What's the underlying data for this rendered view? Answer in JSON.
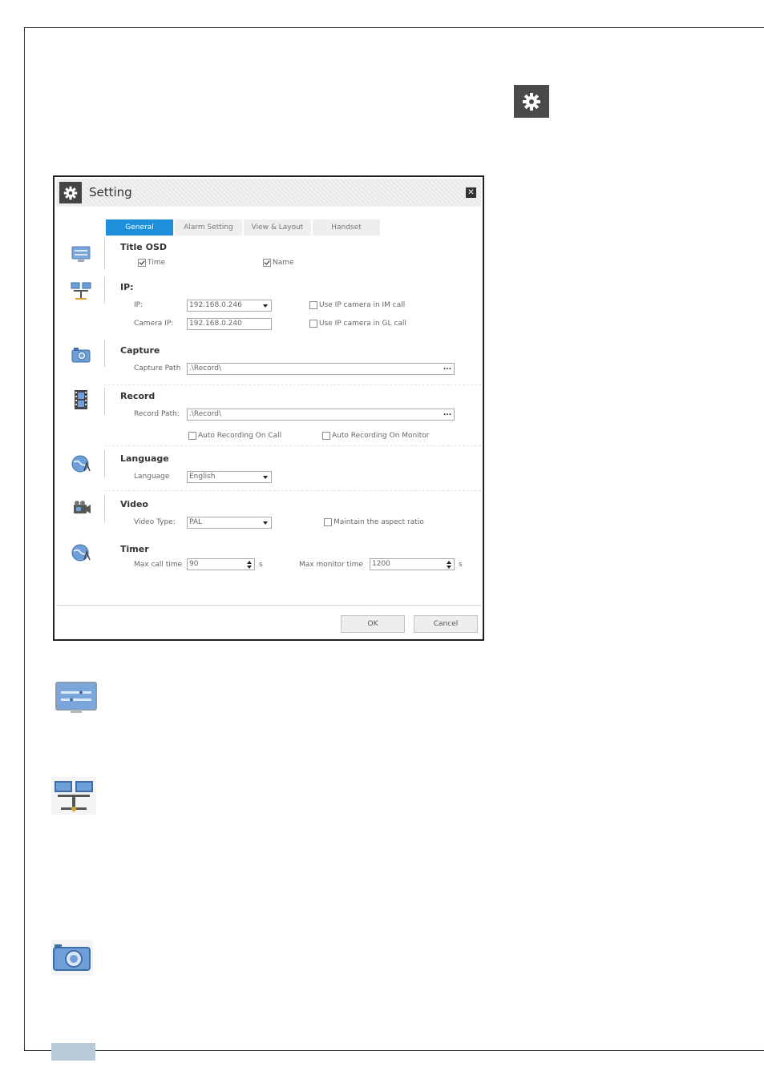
{
  "dialog": {
    "title": "Setting",
    "close_glyph": "✕",
    "tabs": [
      "General",
      "Alarm Setting",
      "View & Layout",
      "Handset"
    ],
    "title_osd": {
      "heading": "Title OSD",
      "time_label": "Time",
      "time_checked": true,
      "name_label": "Name",
      "name_checked": true
    },
    "ip": {
      "heading": "IP:",
      "ip_label": "IP:",
      "ip_value": "192.168.0.246",
      "camera_ip_label": "Camera IP:",
      "camera_ip_value": "192.168.0.240",
      "use_ip_im_label": "Use IP camera in IM call",
      "use_ip_im_checked": false,
      "use_ip_gl_label": "Use IP camera in GL call",
      "use_ip_gl_checked": false
    },
    "capture": {
      "heading": "Capture",
      "path_label": "Capture Path",
      "path_value": ".\\Record\\",
      "browse": "..."
    },
    "record": {
      "heading": "Record",
      "path_label": "Record Path:",
      "path_value": ".\\Record\\",
      "browse": "...",
      "auto_call_label": "Auto Recording On Call",
      "auto_call_checked": false,
      "auto_monitor_label": "Auto Recording On Monitor",
      "auto_monitor_checked": false
    },
    "language": {
      "heading": "Language",
      "label": "Language",
      "value": "English"
    },
    "video": {
      "heading": "Video",
      "type_label": "Video Type:",
      "type_value": "PAL",
      "aspect_label": "Maintain the aspect ratio",
      "aspect_checked": false
    },
    "timer": {
      "heading": "Timer",
      "max_call_label": "Max call time",
      "max_call_value": "90",
      "max_call_unit": "s",
      "max_monitor_label": "Max monitor time",
      "max_monitor_value": "1200",
      "max_monitor_unit": "s"
    },
    "ok_label": "OK",
    "cancel_label": "Cancel"
  },
  "colors": {
    "tab_active": "#1e8fdb",
    "icon_blue": "#6f9fd8",
    "gear_bg": "#4a4a4a"
  },
  "icons": [
    "gear-icon",
    "monitor-osd-icon",
    "network-icon",
    "camera-icon",
    "film-icon",
    "globe-icon",
    "video-camera-icon"
  ]
}
